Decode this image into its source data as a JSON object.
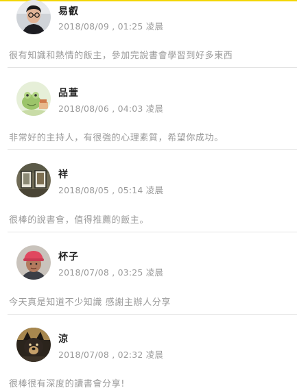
{
  "accent_color": "#f3d600",
  "reviews": [
    {
      "name": "易叡",
      "datetime": "2018/08/09 , 01:25 凌晨",
      "comment": "很有知識和熱情的飯主，參加完說書會學習到好多東西",
      "avatar_icon": "person-glasses-avatar"
    },
    {
      "name": "品萱",
      "datetime": "2018/08/06 , 04:03 凌晨",
      "comment": "非常好的主持人，有很強的心理素質，希望你成功。",
      "avatar_icon": "cartoon-frog-avatar"
    },
    {
      "name": "祥",
      "datetime": "2018/08/05 , 05:14 凌晨",
      "comment": "很棒的說書會，值得推薦的飯主。",
      "avatar_icon": "photo-frames-avatar"
    },
    {
      "name": "杯子",
      "datetime": "2018/07/08 , 03:25 凌晨",
      "comment": "今天真是知道不少知識 感謝主辦人分享",
      "avatar_icon": "person-pink-cap-avatar"
    },
    {
      "name": "涼",
      "datetime": "2018/07/08 , 02:32 凌晨",
      "comment": "很棒很有深度的讀書會分享!",
      "avatar_icon": "dog-avatar"
    }
  ]
}
